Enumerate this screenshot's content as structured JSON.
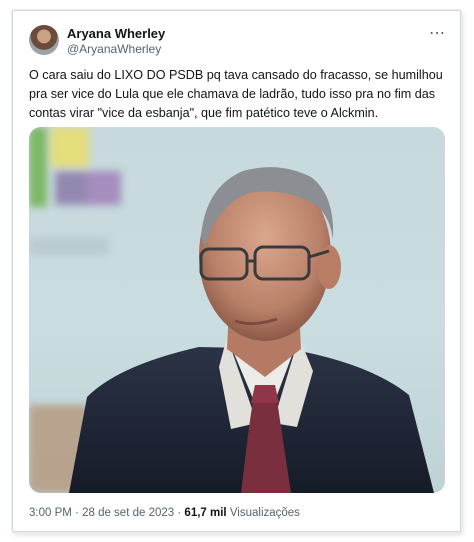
{
  "tweet": {
    "author_name": "Aryana Wherley",
    "author_handle": "@AryanaWherley",
    "more_icon": "⋯",
    "text": "O cara saiu do LIXO DO PSDB pq tava cansado do fracasso, se humilhou pra ser vice do Lula que ele chamava de ladrão, tudo isso pra no fim das contas virar \"vice da esbanja\", que fim patético teve o Alckmin.",
    "time": "3:00 PM",
    "separator": "·",
    "date": "28 de set de 2023",
    "views_count": "61,7 mil",
    "views_label": "Visualizações"
  },
  "colors": {
    "text": "#0f1419",
    "secondary": "#536471",
    "border": "#cfd9de"
  }
}
